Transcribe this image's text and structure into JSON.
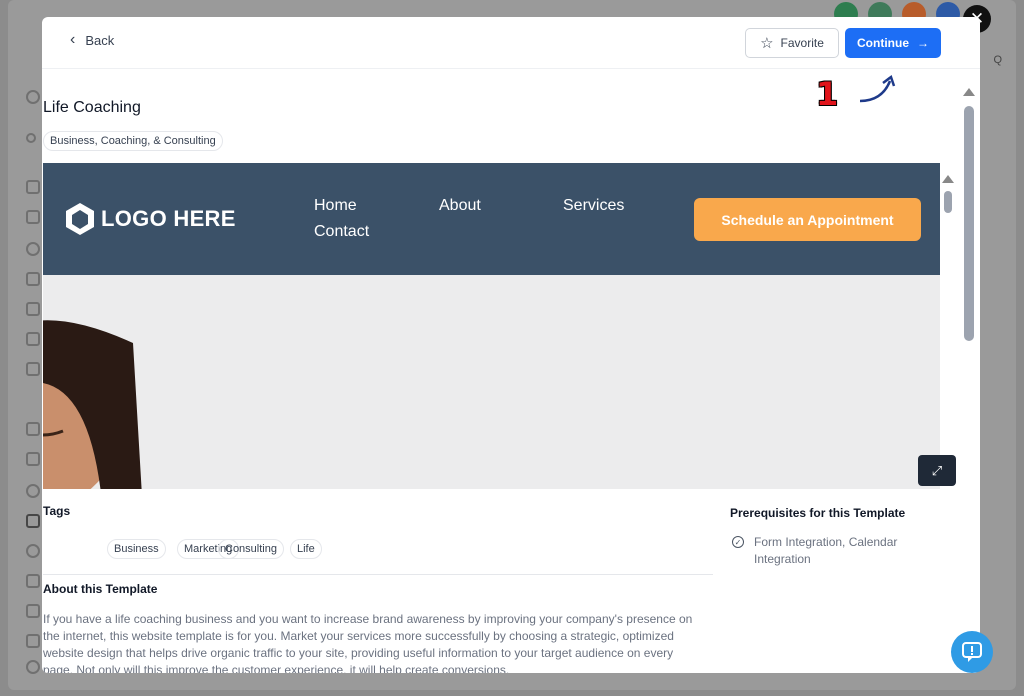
{
  "header": {
    "back_label": "Back",
    "favorite_label": "Favorite",
    "continue_label": "Continue",
    "annotation_step": "1"
  },
  "template": {
    "title": "Life Coaching",
    "category": "Business, Coaching, & Consulting"
  },
  "preview": {
    "logo_text": "LOGO HERE",
    "nav": [
      "Home",
      "About",
      "Services",
      "Contact"
    ],
    "cta_label": "Schedule an Appointment"
  },
  "tags": {
    "heading": "Tags",
    "items": [
      "Business",
      "Marketing",
      "Consulting",
      "Life"
    ]
  },
  "about": {
    "heading": "About this Template",
    "text": "If you have a life coaching business and you want to increase brand awareness by improving your company's presence on the internet, this website template is for you. Market your services more successfully by choosing a strategic, optimized website design that helps drive organic traffic to your site, providing useful information to your target audience on every page. Not only will this improve the customer experience, it will help create conversions."
  },
  "prerequisites": {
    "heading": "Prerequisites for this Template",
    "items": [
      "Form Integration, Calendar Integration"
    ]
  },
  "background": {
    "right_letter": "Q"
  },
  "colors": {
    "accent": "#1d6ef5",
    "nav_bg": "#3b5168",
    "cta": "#f9a84c",
    "annotation": "#e1141b"
  }
}
